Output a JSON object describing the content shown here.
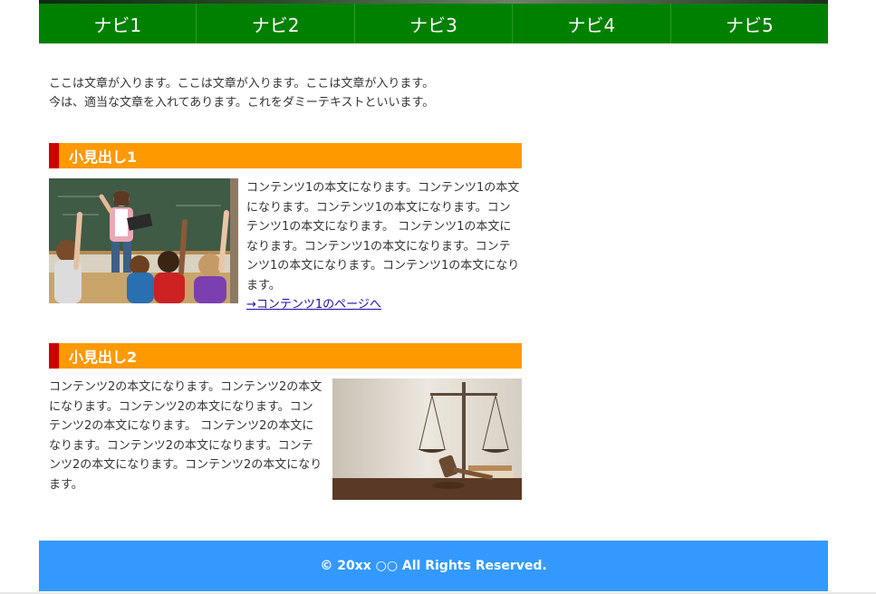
{
  "nav": {
    "items": [
      "ナビ1",
      "ナビ2",
      "ナビ3",
      "ナビ4",
      "ナビ5"
    ]
  },
  "intro": {
    "line1": "ここは文章が入ります。ここは文章が入ります。ここは文章が入ります。",
    "line2": "今は、適当な文章を入れてあります。これをダミーテキストといいます。"
  },
  "section1": {
    "heading": "小見出し1",
    "body": "コンテンツ1の本文になります。コンテンツ1の本文になります。コンテンツ1の本文になります。コンテンツ1の本文になります。 コンテンツ1の本文になります。コンテンツ1の本文になります。コンテンツ1の本文になります。コンテンツ1の本文になります。",
    "link": "→コンテンツ1のページへ"
  },
  "section2": {
    "heading": "小見出し2",
    "body": "コンテンツ2の本文になります。コンテンツ2の本文になります。コンテンツ2の本文になります。コンテンツ2の本文になります。 コンテンツ2の本文になります。コンテンツ2の本文になります。コンテンツ2の本文になります。コンテンツ2の本文になります。"
  },
  "footer": {
    "copyright": "© 20xx ○○ All Rights Reserved."
  },
  "colors": {
    "nav": "#008000",
    "heading": "#ff9900",
    "heading_accent": "#cc0000",
    "footer": "#3399ff",
    "link": "#1a0dab"
  }
}
